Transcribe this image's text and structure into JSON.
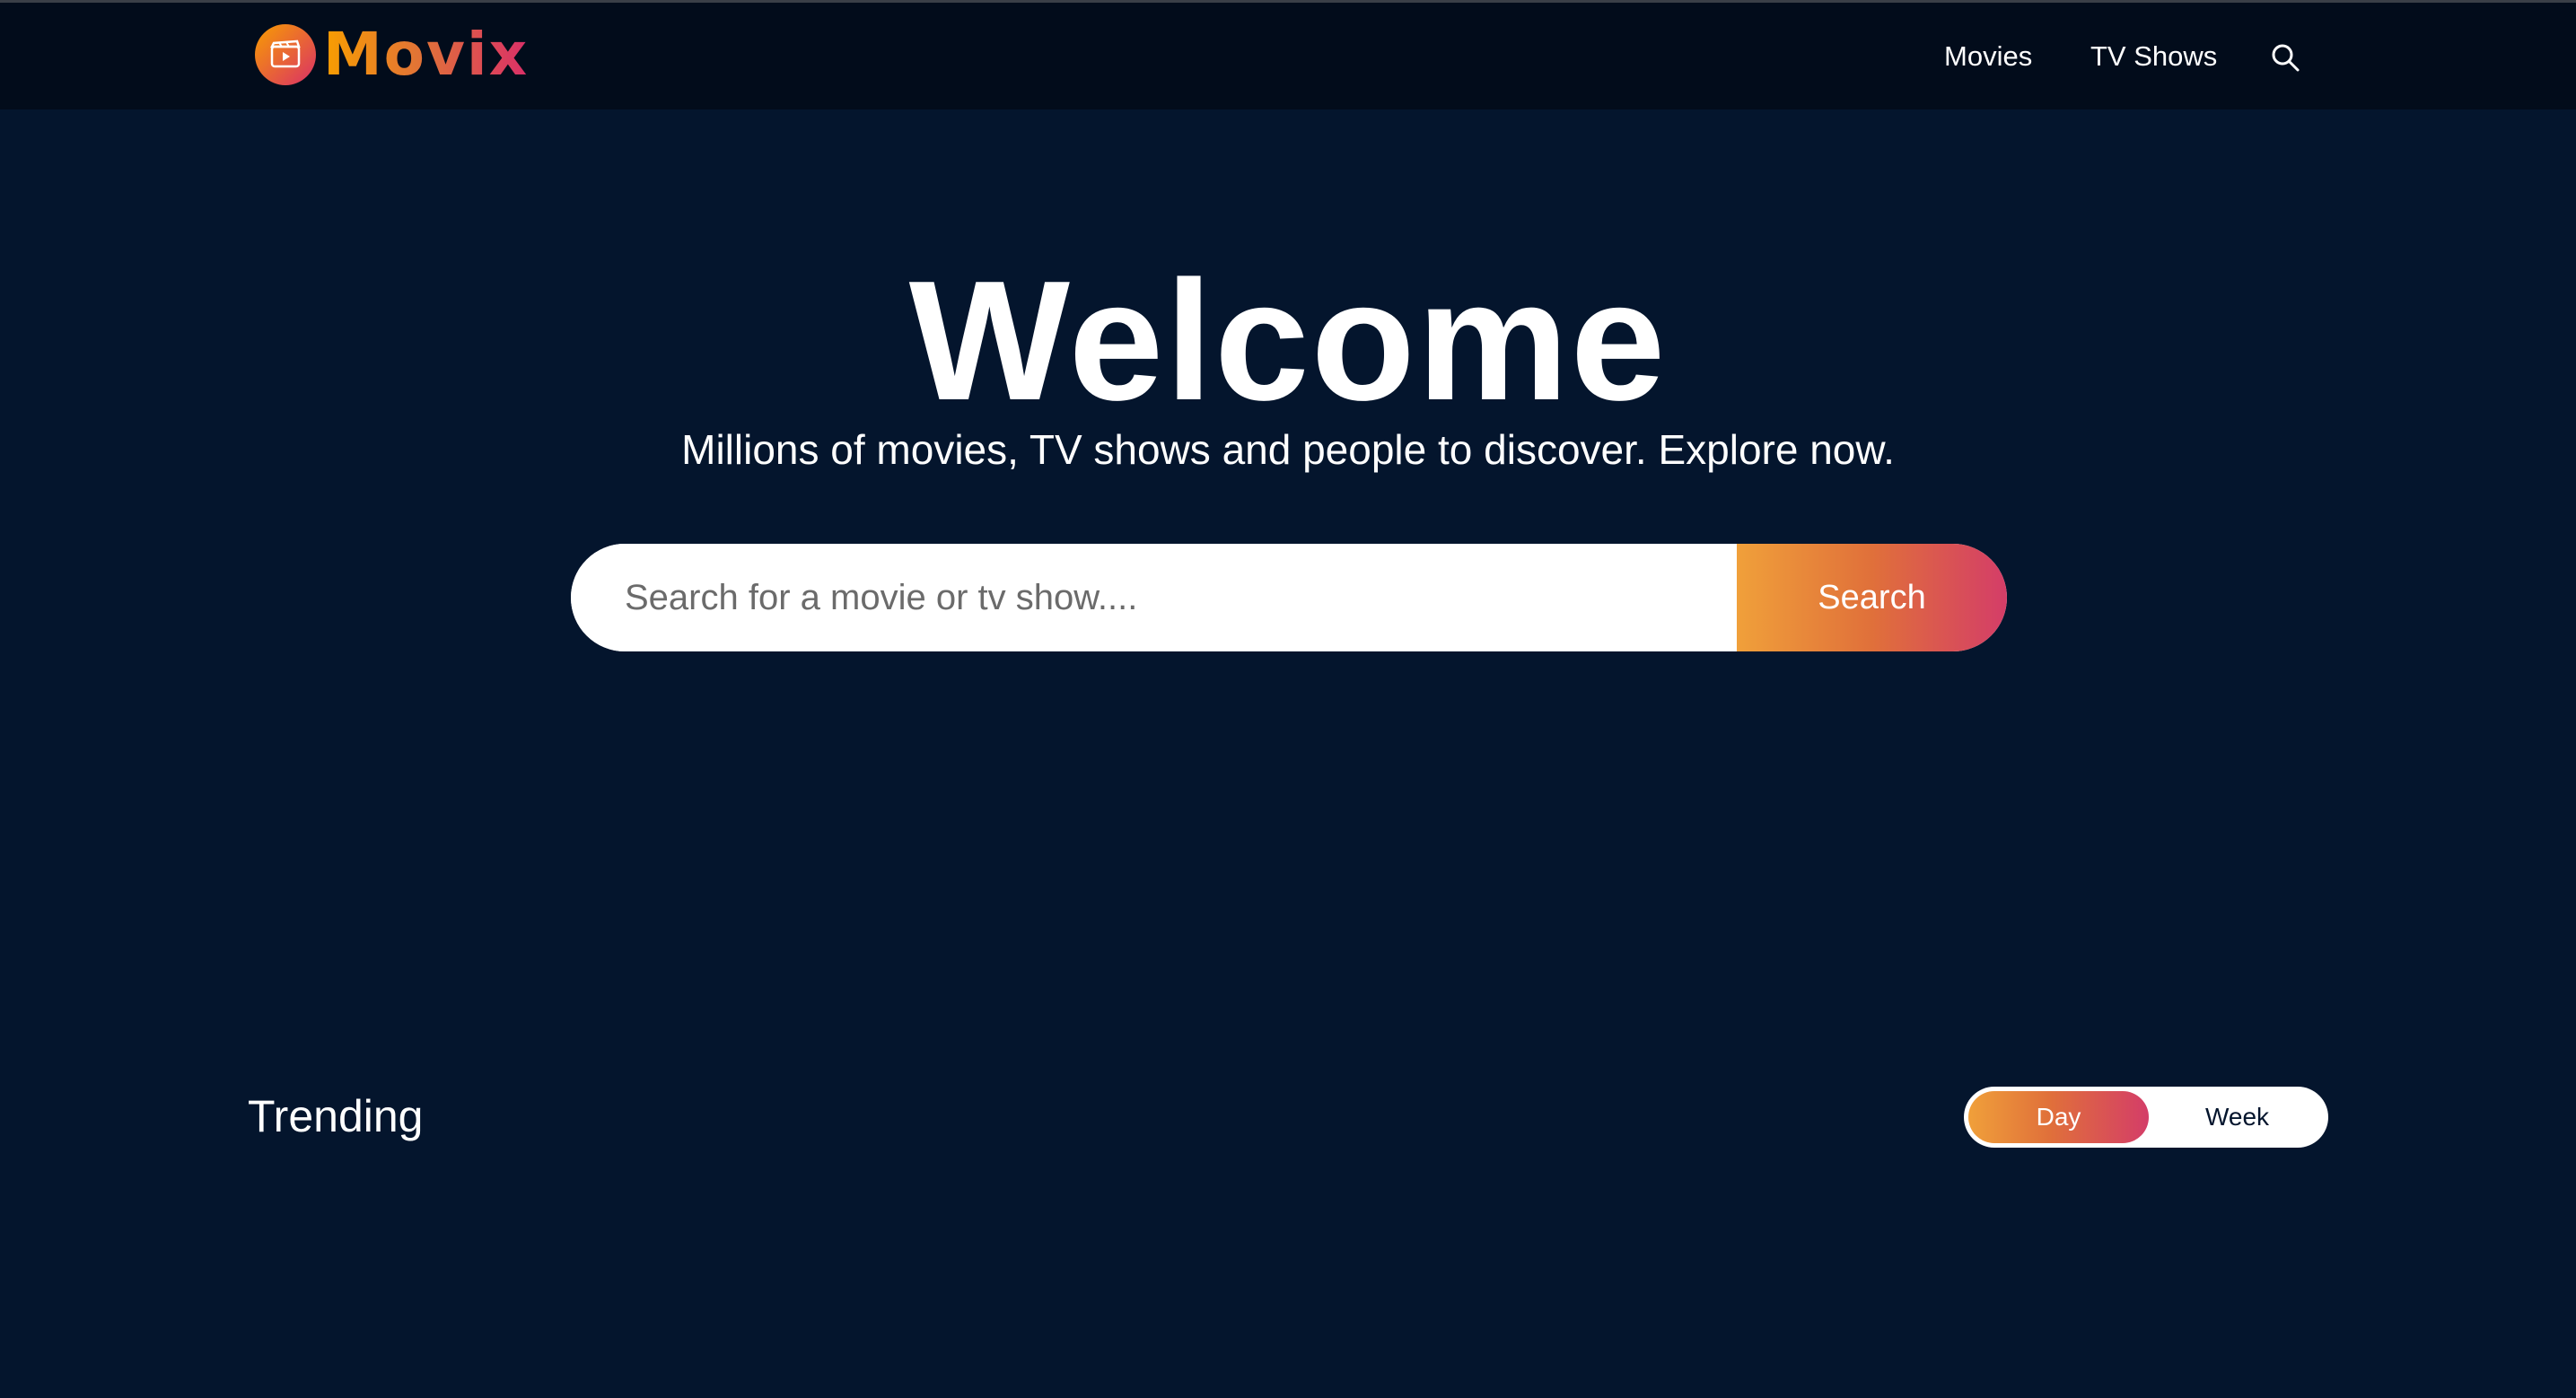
{
  "brand": {
    "name": "Movix",
    "accent_start": "#f89e00",
    "accent_end": "#da2f68"
  },
  "header": {
    "nav": [
      {
        "label": "Movies"
      },
      {
        "label": "TV Shows"
      }
    ],
    "search_icon": "search-icon"
  },
  "hero": {
    "title": "Welcome",
    "subtitle": "Millions of movies, TV shows and people to discover. Explore now.",
    "search_placeholder": "Search for a movie or tv show....",
    "search_button": "Search"
  },
  "trending": {
    "title": "Trending",
    "tabs": [
      {
        "label": "Day",
        "active": true
      },
      {
        "label": "Week",
        "active": false
      }
    ]
  },
  "colors": {
    "background": "#04152d",
    "header_bg": "#020c1b"
  }
}
